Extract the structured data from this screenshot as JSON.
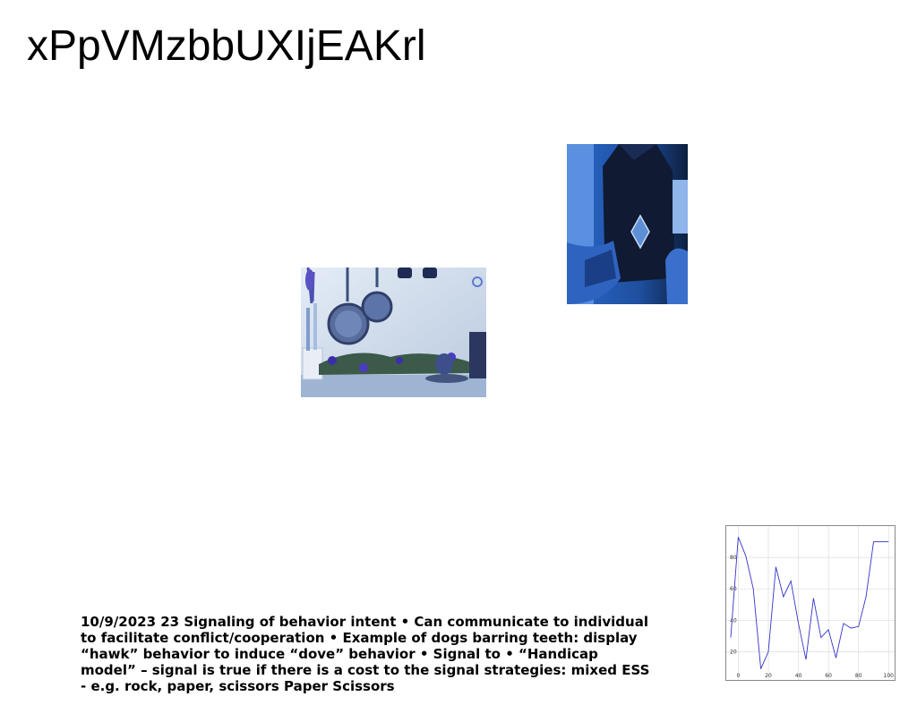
{
  "slide": {
    "title": "xPpVMzbbUXIjEAKrl",
    "caption": "10/9/2023 23 Signaling of behavior intent • Can communicate to individual to facilitate conflict/cooperation • Example of dogs barring teeth: display “hawk” behavior to induce “dove” behavior • Signal to • “Handicap model” – signal is true if there is a cost to the signal strategies: mixed ESS - e.g. rock, paper, scissors Paper Scissors"
  },
  "images": [
    {
      "name": "kitchen-utensils-photo",
      "alt": ""
    },
    {
      "name": "hands-holding-bag-photo",
      "alt": ""
    }
  ],
  "chart_data": {
    "type": "line",
    "title": "",
    "xlabel": "",
    "ylabel": "",
    "grid": true,
    "xlim": [
      -8,
      104
    ],
    "ylim": [
      2,
      100
    ],
    "xticks": [
      0,
      20,
      40,
      60,
      80,
      100
    ],
    "yticks": [
      20,
      40,
      60,
      80
    ],
    "series": [
      {
        "color": "#3333cc",
        "x": [
          -5,
          0,
          5,
          10,
          15,
          20,
          25,
          30,
          35,
          40,
          45,
          50,
          55,
          60,
          65,
          70,
          75,
          80,
          85,
          90,
          95,
          100
        ],
        "y": [
          29,
          93,
          81,
          60,
          9,
          20,
          74,
          55,
          65,
          38,
          15,
          54,
          29,
          34,
          16,
          38,
          35,
          36,
          55,
          90,
          90,
          90
        ]
      }
    ]
  }
}
